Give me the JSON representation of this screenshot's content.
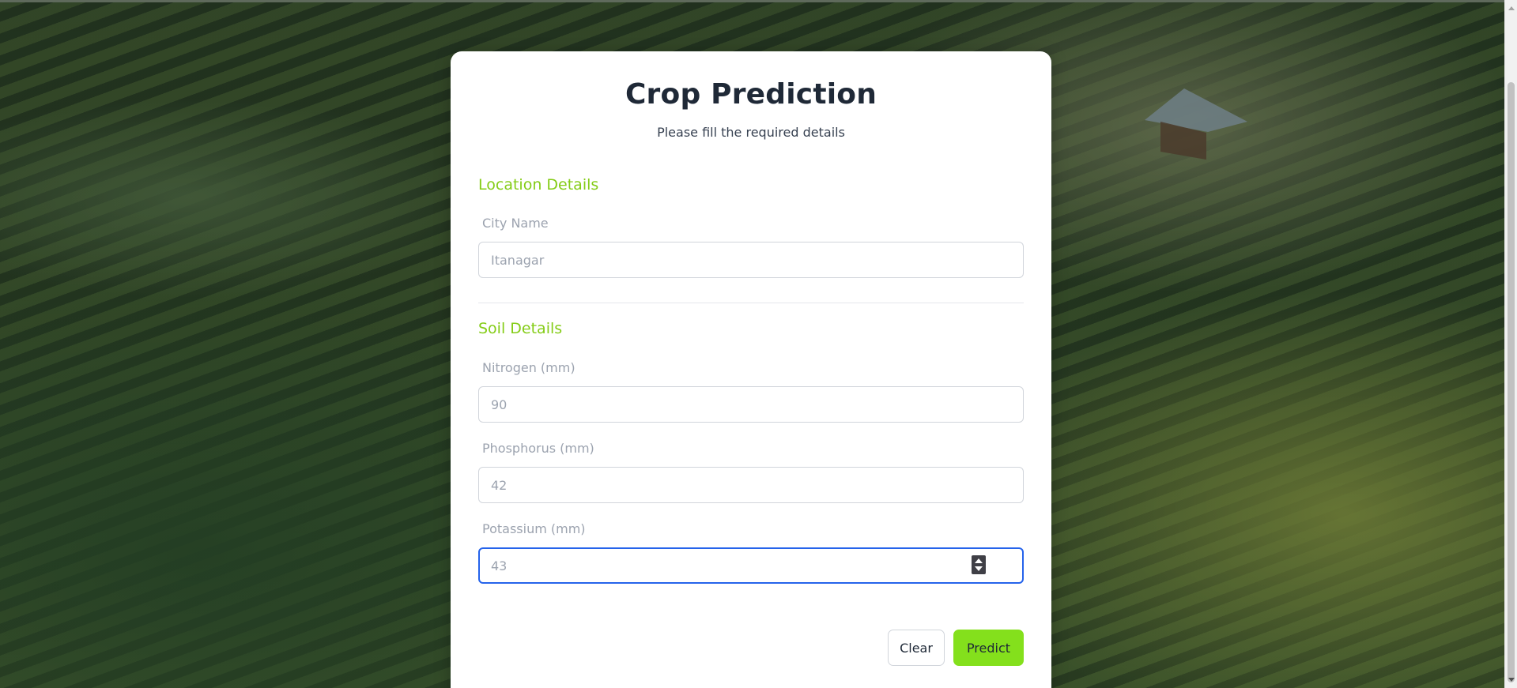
{
  "page": {
    "title": "Crop Prediction",
    "subtitle": "Please fill the required details"
  },
  "location_section": {
    "heading": "Location Details",
    "city": {
      "label": "City Name",
      "placeholder": "Itanagar"
    }
  },
  "soil_section": {
    "heading": "Soil Details",
    "nitrogen": {
      "label": "Nitrogen (mm)",
      "placeholder": "90"
    },
    "phosphorus": {
      "label": "Phosphorus (mm)",
      "placeholder": "42"
    },
    "potassium": {
      "label": "Potassium (mm)",
      "placeholder": "43"
    }
  },
  "actions": {
    "clear_label": "Clear",
    "predict_label": "Predict"
  },
  "icons": {
    "spinner": "number-spinner-icon"
  },
  "colors": {
    "accent": "#84cc16",
    "predict_button": "#84e01c",
    "focus_border": "#2563eb",
    "title_text": "#1f2937"
  }
}
